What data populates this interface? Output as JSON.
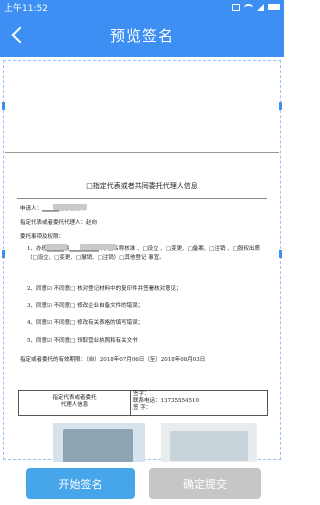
{
  "status": {
    "time": "上午11:52"
  },
  "header": {
    "title": "预览签名"
  },
  "document": {
    "title": "□指定代表或者共同委托代理人信息",
    "applicant": "申请人：▁▁▁▁搬家服务部",
    "delegate": "指定代表或者委托代理人：赵向",
    "items_heading": "委托事项及权限：",
    "item1": "1、办理▁▁▁▁县▁▁▁▁▁▁▁ 的 □名称核准 、□设立 、□变更、□备案、□注销 、□股权出质（□设立、□变更、□撤销、□注销）□其他登记 事宜。",
    "item2": "2、同意☑ 不同意□ 核对登记材料中的复印件并签署核对意见；",
    "item3": "3、同意☑ 不同意□ 修改企业自备文件的错误；",
    "item4": "4、同意☑ 不同意□ 修改有关表格的填写错误；",
    "item5": "5、同意☑ 不同意□ 领取营业执照和有关文书",
    "validity": "指定或者委托的有效期限：（自）2018年07月06日（至）2018年08月03日",
    "table": {
      "left_line1": "指定代表或者委托",
      "left_line2": "代理人信息",
      "sign_label": "签字：",
      "phone": "联系电话：13735554510",
      "cert_label": "签 字："
    }
  },
  "buttons": {
    "start": "开始签名",
    "submit": "确定提交"
  },
  "colors": {
    "primary": "#3d8ff3",
    "start_button": "#47a6ea",
    "submit_button": "#c6c6c6"
  }
}
